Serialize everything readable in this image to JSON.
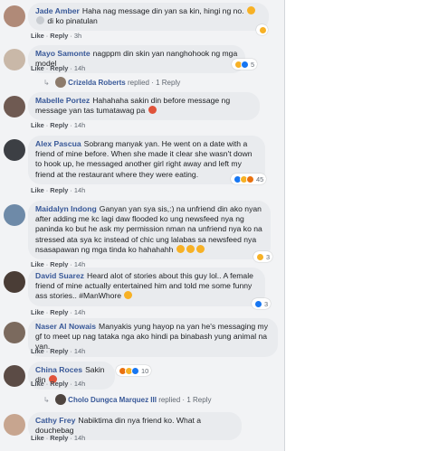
{
  "comments": [
    {
      "name": "Jade Amber",
      "text": "Haha nag message din yan sa kin, hingi ng no.",
      "text2": "di ko pinatulan",
      "time": "3h",
      "react_count": ""
    },
    {
      "name": "Mayo Samonte",
      "text": "nagppm din skin yan nanghohook ng mga model",
      "time": "14h",
      "react_count": "",
      "reply_name": "Crizelda Roberts",
      "reply_text": "replied · 1 Reply"
    },
    {
      "name": "Mabelle Portez",
      "text": "Hahahaha sakin din before message ng message yan tas tumatawag pa",
      "time": "14h"
    },
    {
      "name": "Alex Pascua",
      "text": "Sobrang manyak yan. He went on a date with a friend of mine before. When she made it clear she wasn't down to hook up, he messaged another girl right away and left my friend at the restaurant where they were eating.",
      "time": "14h",
      "react_count": "45"
    },
    {
      "name": "Maidalyn Indong",
      "text": "Ganyan yan sya sis,:) na unfriend din ako nyan after adding me kc lagi daw flooded ko ung newsfeed nya ng paninda ko but he ask my permission nman na unfriend nya ko na stressed ata sya kc instead of chic ung lalabas sa newsfeed nya nsasapawan ng mga tinda ko hahahahh",
      "time": "14h",
      "react_count": "3"
    },
    {
      "name": "David Suarez",
      "text": "Heard alot of stories about this guy lol.. A female friend of mine actually entertained him and told me some funny ass stories.. #ManWhore",
      "time": "14h",
      "react_count": "3"
    },
    {
      "name": "Naser Al Nowais",
      "text": "Manyakis yung hayop na yan he's messaging my gf to meet up nag tataka nga ako hindi pa binabash yung animal na yan.",
      "time": "14h"
    },
    {
      "name": "China Roces",
      "text": "Sakin din",
      "time": "14h",
      "react_count": "10",
      "reply_name": "Cholo Dungca Marquez III",
      "reply_text": "replied · 1 Reply"
    },
    {
      "name": "Cathy Frey",
      "text": "Nabiktima din nya friend ko. What a douchebag",
      "time": "14h"
    }
  ],
  "actions": {
    "like": "Like",
    "reply": "Reply",
    "dot": "·"
  },
  "colors": {
    "name": "#385898",
    "bubble": "#e9ebee",
    "panel": "#f2f3f5"
  }
}
